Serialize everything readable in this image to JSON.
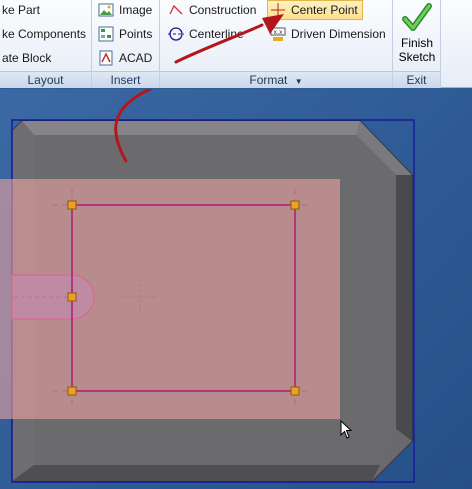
{
  "ribbon": {
    "layout": {
      "items": [
        "ke Part",
        "ke Components",
        "ate Block"
      ],
      "label": "Layout"
    },
    "insert": {
      "items": [
        "Image",
        "Points",
        "ACAD"
      ],
      "label": "Insert"
    },
    "format": {
      "construction": "Construction",
      "centerline": "Centerline",
      "center_point": "Center Point",
      "driven_dimension": "Driven Dimension",
      "label": "Format",
      "dropdown_glyph": "▼"
    },
    "exit": {
      "finish_line1": "Finish",
      "finish_line2": "Sketch",
      "label": "Exit"
    }
  },
  "colors": {
    "accent_arrow": "#b3161b",
    "sketch_line": "#b0207a",
    "grip": "#f0a020",
    "part_face": "#6b6b6e",
    "selection_fill": "#e8a0a0",
    "boundary": "#1a1a9a"
  }
}
